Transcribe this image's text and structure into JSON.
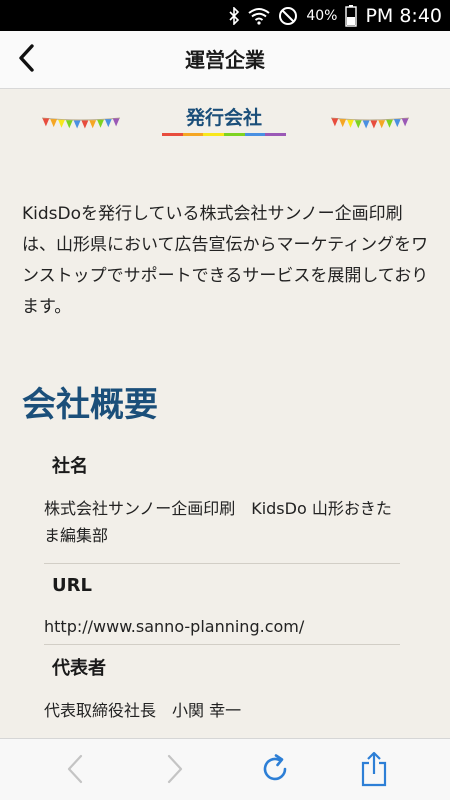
{
  "status_bar": {
    "battery": "40%",
    "time": "PM 8:40"
  },
  "nav": {
    "title": "運営企業",
    "back_icon": "chevron-left-icon"
  },
  "section": {
    "title": "発行会社",
    "underline_colors": [
      "#e84c3d",
      "#f5a623",
      "#f8e71c",
      "#7ed321",
      "#4a90e2",
      "#9b59b6"
    ],
    "garland_colors": [
      "#e84c3d",
      "#f5a623",
      "#f8e71c",
      "#7ed321",
      "#4a90e2",
      "#e84c3d",
      "#f5a623",
      "#7ed321",
      "#4a90e2",
      "#9b59b6"
    ]
  },
  "intro": "KidsDoを発行している株式会社サンノー企画印刷は、山形県において広告宣伝からマーケティングをワンストップでサポートできるサービスを展開しております。",
  "overview": {
    "heading": "会社概要",
    "items": [
      {
        "label": "社名",
        "value": "株式会社サンノー企画印刷　KidsDo 山形おきたま編集部"
      },
      {
        "label": "URL",
        "value": "http://www.sanno-planning.com/"
      },
      {
        "label": "代表者",
        "value": "代表取締役社長　小関 幸一"
      }
    ]
  },
  "toolbar": {
    "back_icon": "arrow-back-icon",
    "forward_icon": "arrow-forward-icon",
    "reload_icon": "reload-icon",
    "share_icon": "share-icon"
  },
  "colors": {
    "accent": "#1b4f7a",
    "reload": "#2d7fd6"
  }
}
